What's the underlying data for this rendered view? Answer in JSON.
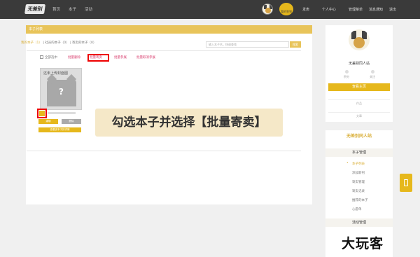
{
  "topbar": {
    "logo_text": "无差别",
    "nav": [
      "首页",
      "本子",
      "活动"
    ],
    "badge": "我的签到",
    "links": [
      "发表",
      "个人中心",
      "管理菜单",
      "消息通知",
      "退出"
    ]
  },
  "panel": {
    "header": "本子列表",
    "subtabs": [
      "我的本子（1）",
      "社员的本子（0）",
      "寄卖的本子（0）"
    ],
    "search_placeholder": "输入本子名，快速查找",
    "search_button": "搜索",
    "select_all": "全部选中",
    "ops": [
      "批量删除",
      "批量寄卖",
      "批量参展",
      "批量取消参展"
    ],
    "card": {
      "title": "还未上传封面图",
      "edit": "编辑",
      "delete": "删除",
      "ask": "查看该本子的详情"
    },
    "overlay": "勾选本子并选择【批量寄卖】"
  },
  "profile": {
    "name": "无差别同人站",
    "stats": [
      "积分",
      "关注"
    ],
    "button": "查看主页",
    "rows": [
      "作品",
      "文章"
    ]
  },
  "manage": {
    "logo": "无差别同人站",
    "head1": "本子管理",
    "items": [
      "本子列表",
      "添加新刊",
      "寄卖管理",
      "寄卖记录",
      "推荐的本子",
      "心愿单"
    ],
    "head2": "活动管理"
  },
  "watermark": "大玩客",
  "colors": {
    "accent": "#e6b81c",
    "topbar": "#3a3a3a",
    "highlight": "#e00000"
  }
}
